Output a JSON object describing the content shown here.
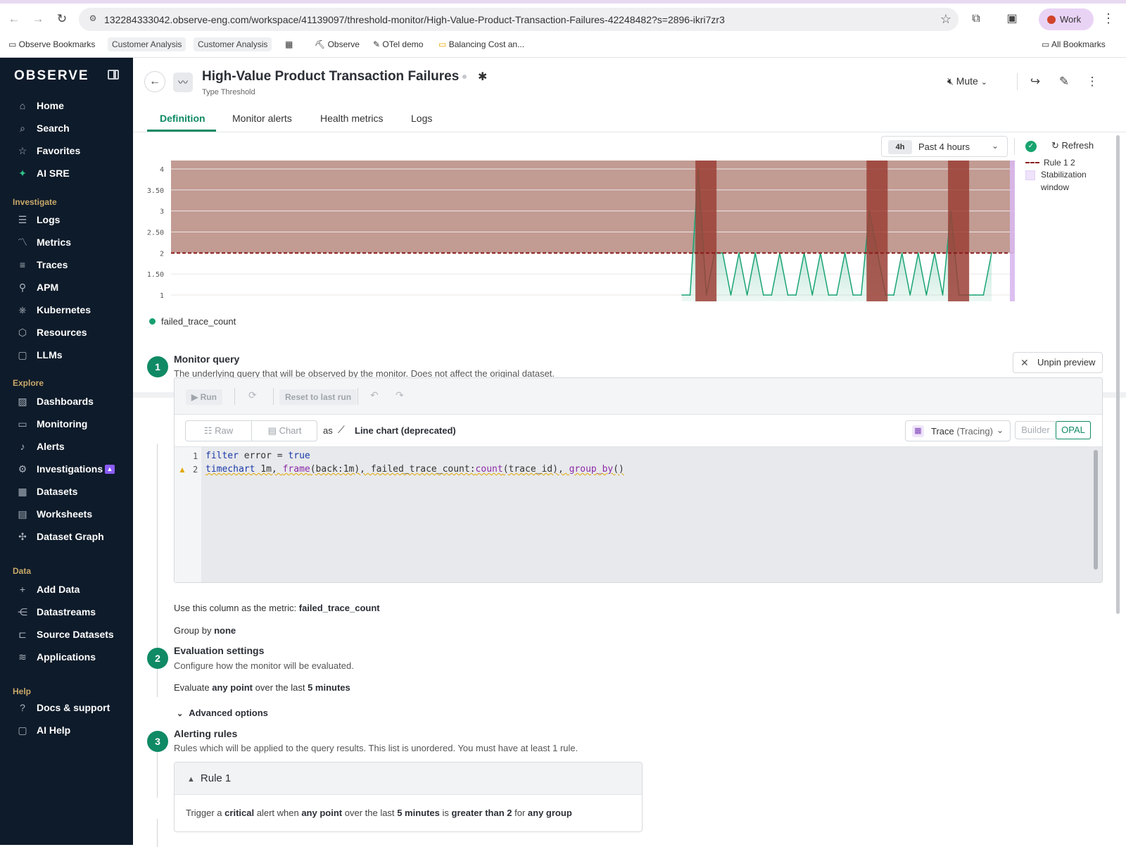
{
  "browser": {
    "url": "132284333042.observe-eng.com/workspace/41139097/threshold-monitor/High-Value-Product-Transaction-Failures-42248482?s=2896-ikri7zr3",
    "profile": "Work",
    "bookmarks": [
      "Observe Bookmarks",
      "Customer Analysis",
      "Customer Analysis",
      "Observe",
      "OTel demo",
      "Balancing Cost an...",
      "All Bookmarks"
    ]
  },
  "sidebar": {
    "logo": "OBSERVE",
    "top_items": [
      "Home",
      "Search",
      "Favorites",
      "AI SRE"
    ],
    "investigate_header": "Investigate",
    "investigate_items": [
      "Logs",
      "Metrics",
      "Traces",
      "APM",
      "Kubernetes",
      "Resources",
      "LLMs"
    ],
    "explore_header": "Explore",
    "explore_items": [
      "Dashboards",
      "Monitoring",
      "Alerts",
      "Investigations",
      "Datasets",
      "Worksheets",
      "Dataset Graph"
    ],
    "data_header": "Data",
    "data_items": [
      "Add Data",
      "Datastreams",
      "Source Datasets",
      "Applications"
    ],
    "help_header": "Help",
    "help_items": [
      "Docs & support",
      "AI Help"
    ]
  },
  "header": {
    "title": "High-Value Product Transaction Failures",
    "type_label": "Type Threshold",
    "mute_label": "Mute"
  },
  "tabs": [
    "Definition",
    "Monitor alerts",
    "Health metrics",
    "Logs"
  ],
  "chart": {
    "time_chip": "4h",
    "time_label": "Past 4 hours",
    "refresh_label": "Refresh",
    "legend_rule": "Rule 1 2",
    "legend_stab": "Stabilization window",
    "series_name": "failed_trace_count",
    "colors": {
      "threshold_fill": "#c29b93",
      "alert_band": "#9b3f36",
      "series": "#1aa474",
      "rule_line": "#8b1a1a",
      "stabilization": "#d9b8f0"
    }
  },
  "chart_data": {
    "type": "area",
    "yticks": [
      "1",
      "1.50",
      "2",
      "2.50",
      "3",
      "3.50",
      "4"
    ],
    "ylim": [
      0.85,
      4.2
    ],
    "threshold": 2,
    "series": [
      {
        "name": "failed_trace_count",
        "values": [
          1,
          1,
          4,
          1,
          2,
          2,
          1,
          2,
          1,
          2,
          1,
          1,
          2,
          1,
          1,
          2,
          1,
          2,
          1,
          1,
          2,
          1,
          1,
          3,
          2,
          1,
          1,
          2,
          1,
          2,
          1,
          2,
          1,
          3,
          1,
          1,
          1,
          1,
          2
        ]
      }
    ]
  },
  "monitor_query": {
    "step": "1",
    "title": "Monitor query",
    "desc": "The underlying query that will be observed by the monitor. Does not affect the original dataset.",
    "unpin": "Unpin preview",
    "run": "Run",
    "reset": "Reset to last run",
    "raw": "Raw",
    "chart": "Chart",
    "as": "as",
    "chart_type": "Line chart (deprecated)",
    "dataset": "Trace",
    "dataset_sub": "(Tracing)",
    "builder": "Builder",
    "opal": "OPAL",
    "code_lines": [
      "filter error = true",
      "timechart 1m, frame(back:1m), failed_trace_count:count(trace_id), group_by()"
    ],
    "metric_prefix": "Use this column as the metric:",
    "metric": "failed_trace_count",
    "group_prefix": "Group by",
    "group": "none"
  },
  "evaluation": {
    "step": "2",
    "title": "Evaluation settings",
    "desc": "Configure how the monitor will be evaluated.",
    "eval_prefix": "Evaluate",
    "eval_point": "any point",
    "eval_mid": "over the last",
    "eval_window": "5 minutes",
    "advanced": "Advanced options"
  },
  "alerting": {
    "step": "3",
    "title": "Alerting rules",
    "desc": "Rules which will be applied to the query results. This list is unordered. You must have at least 1 rule.",
    "rule_title": "Rule 1",
    "rule_parts": [
      "Trigger a",
      "critical",
      "alert when",
      "any point",
      "over the last",
      "5 minutes",
      "is",
      "greater than 2",
      "for",
      "any group"
    ]
  }
}
